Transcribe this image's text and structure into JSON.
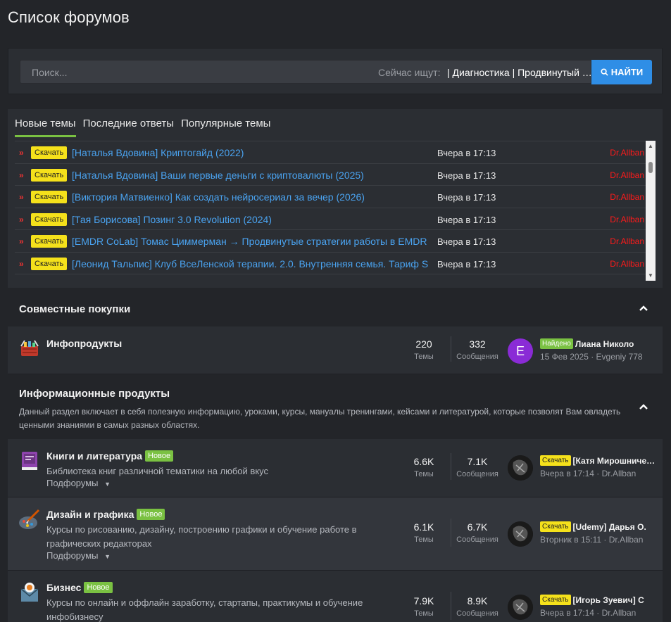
{
  "page_title": "Список форумов",
  "search": {
    "placeholder": "Поиск...",
    "now_label": "Сейчас ищут:",
    "now_value": "| Диагностика | Продвинутый курс",
    "button_label": "НАЙТИ"
  },
  "tabs": [
    {
      "label": "Новые темы"
    },
    {
      "label": "Последние ответы"
    },
    {
      "label": "Популярные темы"
    }
  ],
  "topics": [
    {
      "badge": "Скачать",
      "title": "[Наталья Вдовина] Криптогайд (2022)",
      "time": "Вчера в 17:13",
      "user": "Dr.Allban"
    },
    {
      "badge": "Скачать",
      "title": "[Наталья Вдовина] Ваши первые деньги с криптовалюты (2025)",
      "time": "Вчера в 17:13",
      "user": "Dr.Allban"
    },
    {
      "badge": "Скачать",
      "title": "[Виктория Матвиенко] Как создать нейросериал за вечер (2026)",
      "time": "Вчера в 17:13",
      "user": "Dr.Allban"
    },
    {
      "badge": "Скачать",
      "title": "[Тая Борисова] Позинг 3.0 Revolution (2024)",
      "time": "Вчера в 17:13",
      "user": "Dr.Allban"
    },
    {
      "badge": "Скачать",
      "title": "[EMDR CoLab] Томас Циммерман → Продвинутые стратегии работы в EMDR",
      "time": "Вчера в 17:13",
      "user": "Dr.Allban"
    },
    {
      "badge": "Скачать",
      "title": "[Леонид Тальпис] Клуб ВсеЛенской терапии. 2.0. Внутренняя семья. Тариф S",
      "time": "Вчера в 17:13",
      "user": "Dr.Allban"
    }
  ],
  "categories": {
    "joint": {
      "title": "Совместные покупки"
    },
    "info": {
      "title": "Информационные продукты",
      "description": "Данный раздел включает в себя полезную информацию, уроками, курсы, мануалы тренингами, кейсами и литературой, которые позволят Вам овладеть ценными знаниями в самых разных областях."
    }
  },
  "forums": {
    "infoproducts": {
      "name": "Инфопродукты",
      "topics": "220",
      "topics_label": "Темы",
      "posts": "332",
      "posts_label": "Сообщения",
      "avatar_letter": "E",
      "last_badge": "Найдено",
      "last_title": "Лиана Николо",
      "last_meta": "15 Фев 2025 · Evgeniy 778"
    },
    "books": {
      "name": "Книги и литература",
      "badge": "Новое",
      "description": "Библиотека книг различной тематики на любой вкус",
      "subforums": "Подфорумы",
      "topics": "6.6K",
      "topics_label": "Темы",
      "posts": "7.1K",
      "posts_label": "Сообщения",
      "last_badge": "Скачать",
      "last_title": "[Катя Мирошниченко]",
      "last_meta": "Вчера в 17:14 · Dr.Allban"
    },
    "design": {
      "name": "Дизайн и графика",
      "badge": "Новое",
      "description": "Курсы по рисованию, дизайну, построению графики и обучение работе в графических редакторах",
      "subforums": "Подфорумы",
      "topics": "6.1K",
      "topics_label": "Темы",
      "posts": "6.7K",
      "posts_label": "Сообщения",
      "last_badge": "Скачать",
      "last_title": "[Udemy] Дарья О.",
      "last_meta": "Вторник в 15:11 · Dr.Allban"
    },
    "business": {
      "name": "Бизнес",
      "badge": "Новое",
      "description": "Курсы по онлайн и оффлайн заработку, стартапы, практикумы и обучение инфобизнесу",
      "topics": "7.9K",
      "topics_label": "Темы",
      "posts": "8.9K",
      "posts_label": "Сообщения",
      "last_badge": "Скачать",
      "last_title": "[Игорь Зуевич] С",
      "last_meta": "Вчера в 17:14 · Dr.Allban"
    }
  }
}
